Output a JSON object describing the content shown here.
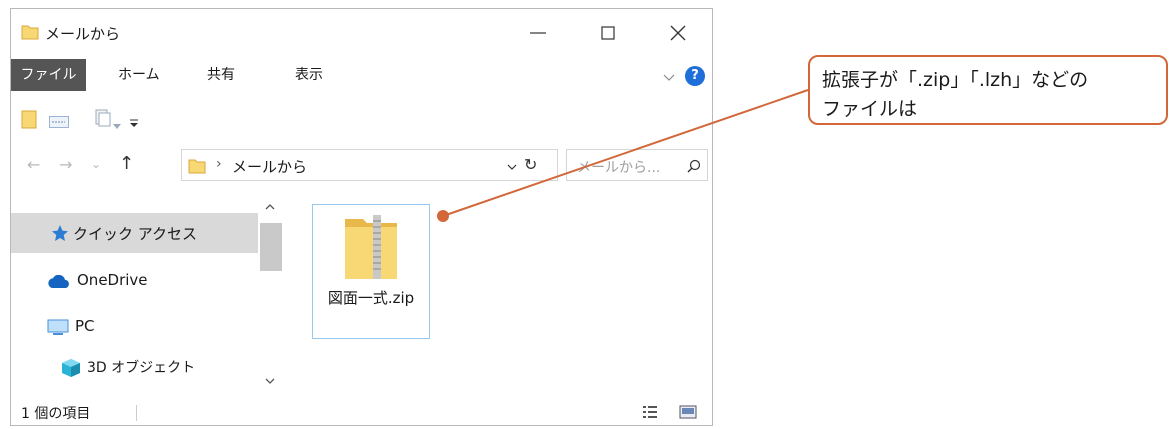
{
  "window": {
    "title": "メールから",
    "minimize_label": "—",
    "maximize_label": "☐",
    "close_label": "✕"
  },
  "ribbon": {
    "tabs": [
      "ファイル",
      "ホーム",
      "共有",
      "表示"
    ],
    "help_label": "?"
  },
  "address": {
    "path": "メールから",
    "separator": "›",
    "refresh_label": "↻"
  },
  "search": {
    "placeholder": "メールから..."
  },
  "nav": {
    "back": "←",
    "forward": "→",
    "recent": "⌄",
    "up": "↑"
  },
  "nav_pane": {
    "items": [
      {
        "label": "クイック アクセス",
        "icon": "star-icon"
      },
      {
        "label": "OneDrive",
        "icon": "cloud-icon"
      },
      {
        "label": "PC",
        "icon": "monitor-icon"
      },
      {
        "label": "3D オブジェクト",
        "icon": "cube-icon"
      }
    ]
  },
  "content": {
    "file_name": "図面一式.zip",
    "file_icon": "zip-folder-icon"
  },
  "status": {
    "count": "1 個の項目"
  },
  "callout": {
    "line1": "拡張子が「.zip」「.lzh」などの",
    "line2": "ファイルは"
  },
  "colors": {
    "accent": "#d2683a",
    "selection": "#99c9ef",
    "folder": "#f8d775"
  }
}
